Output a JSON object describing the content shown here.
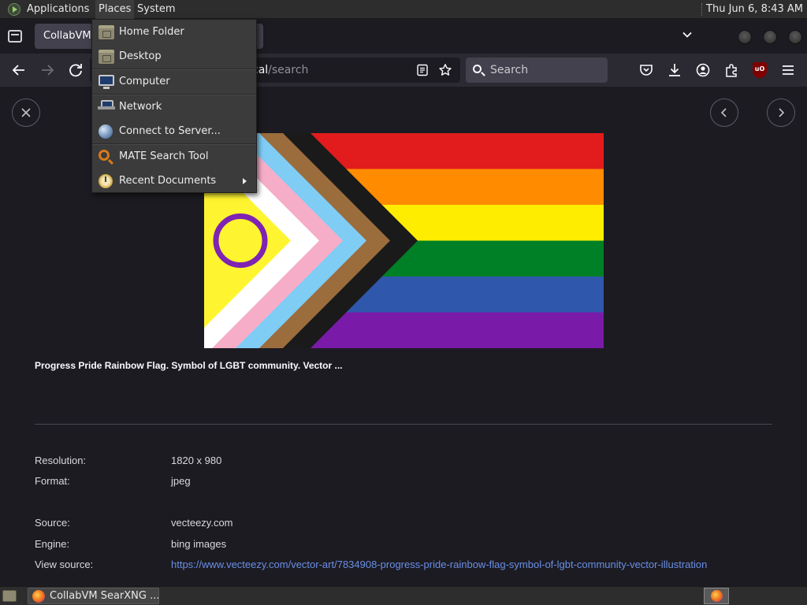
{
  "top_panel": {
    "applications": "Applications",
    "places": "Places",
    "system": "System",
    "clock": "Thu Jun  6,  8:43 AM"
  },
  "browser": {
    "tab_title": "CollabVM",
    "url_host": "",
    "url_prefix": "cal",
    "url_path": "/search",
    "search_placeholder": "Search"
  },
  "places_menu": {
    "items": [
      {
        "label": "Home Folder",
        "icon": "home-folder-icon"
      },
      {
        "label": "Desktop",
        "icon": "desktop-folder-icon"
      },
      {
        "label": "Computer",
        "icon": "computer-icon"
      },
      {
        "label": "Network",
        "icon": "network-icon"
      },
      {
        "label": "Connect to Server...",
        "icon": "globe-icon"
      },
      {
        "label": "MATE Search Tool",
        "icon": "search-tool-icon"
      },
      {
        "label": "Recent Documents",
        "icon": "recent-documents-icon"
      }
    ]
  },
  "result": {
    "title": "Progress Pride Rainbow Flag. Symbol of LGBT community. Vector ...",
    "resolution_label": "Resolution:",
    "resolution_value": "1820 x 980",
    "format_label": "Format:",
    "format_value": "jpeg",
    "source_label": "Source:",
    "source_value": "vecteezy.com",
    "engine_label": "Engine:",
    "engine_value": "bing images",
    "view_source_label": "View source:",
    "view_source_url": "https://www.vecteezy.com/vector-art/7834908-progress-pride-rainbow-flag-symbol-of-lgbt-community-vector-illustration"
  },
  "taskbar": {
    "task_label": "CollabVM SearXNG ..."
  },
  "colors": {
    "flag_red": "#e21c1c",
    "flag_orange": "#ff8c00",
    "flag_yellow": "#ffed00",
    "flag_green": "#008026",
    "flag_blue": "#2f57ac",
    "flag_purple": "#7a1aa8",
    "intersex_yellow": "#fff430",
    "intersex_purple": "#7e23b3",
    "link": "#6a8fe6"
  }
}
